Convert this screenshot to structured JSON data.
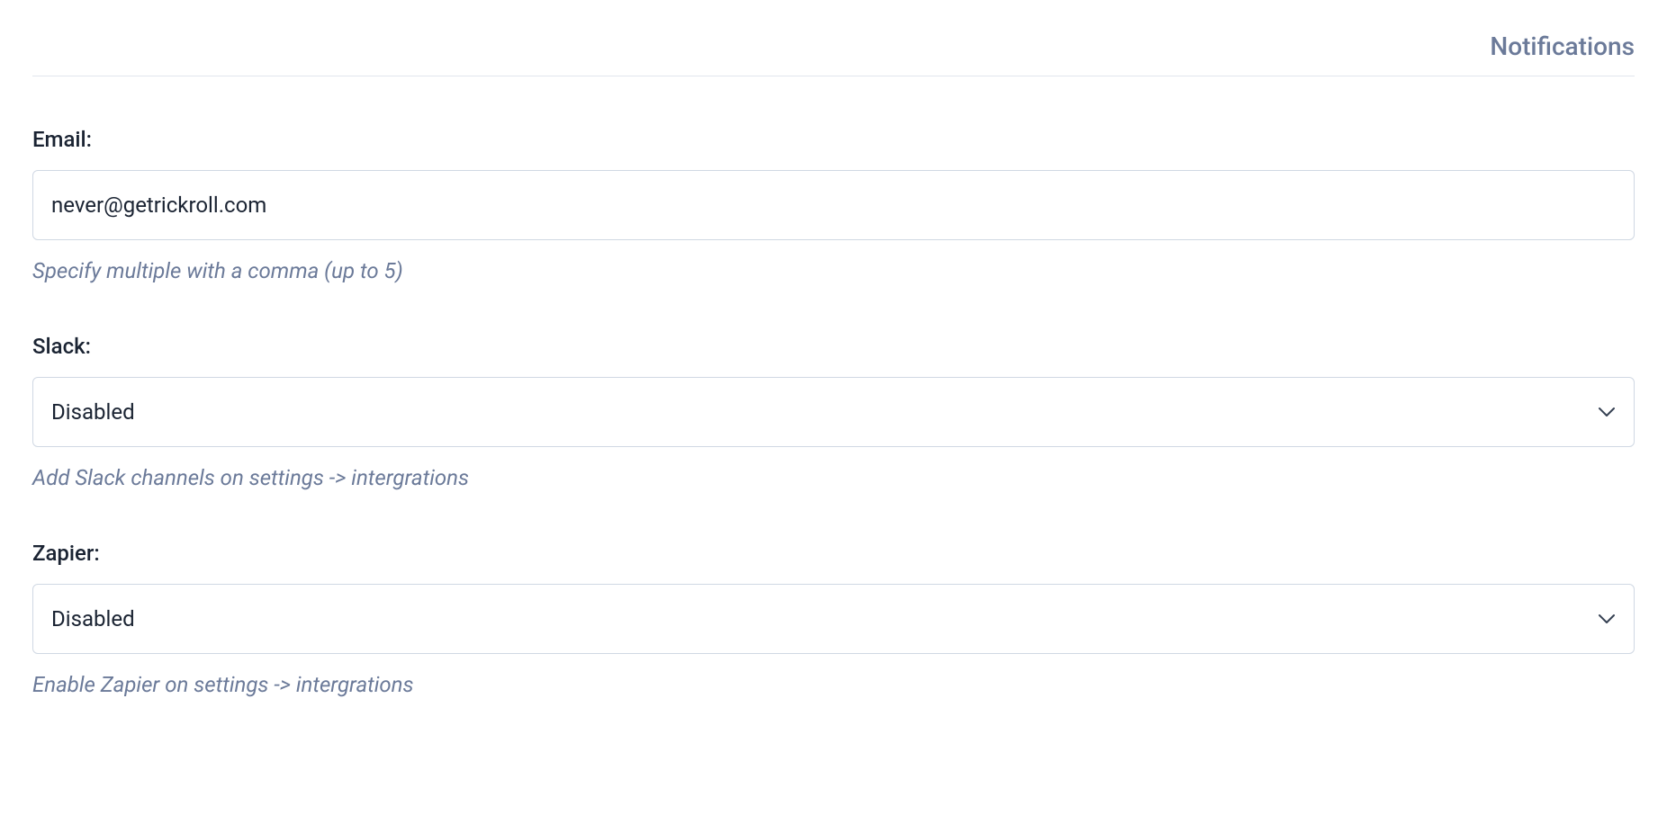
{
  "section": {
    "title": "Notifications"
  },
  "email": {
    "label": "Email:",
    "value": "never@getrickroll.com",
    "help": "Specify multiple with a comma (up to 5)"
  },
  "slack": {
    "label": "Slack:",
    "selected": "Disabled",
    "help": "Add Slack channels on settings -> intergrations"
  },
  "zapier": {
    "label": "Zapier:",
    "selected": "Disabled",
    "help": "Enable Zapier on settings -> intergrations"
  }
}
